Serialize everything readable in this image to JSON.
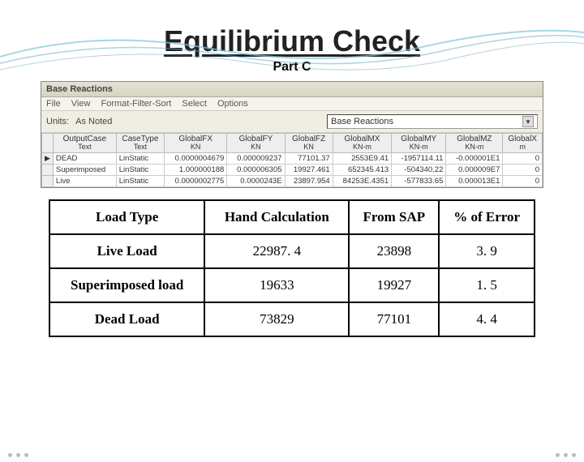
{
  "title": "Equilibrium Check",
  "subtitle": "Part C",
  "sap": {
    "window_title": "Base Reactions",
    "menus": [
      "File",
      "View",
      "Format-Filter-Sort",
      "Select",
      "Options"
    ],
    "units_label": "Units:",
    "units_value": "As Noted",
    "dropdown_value": "Base Reactions",
    "columns": [
      {
        "h1": "OutputCase",
        "h2": "Text"
      },
      {
        "h1": "CaseType",
        "h2": "Text"
      },
      {
        "h1": "GlobalFX",
        "h2": "KN"
      },
      {
        "h1": "GlobalFY",
        "h2": "KN"
      },
      {
        "h1": "GlobalFZ",
        "h2": "KN"
      },
      {
        "h1": "GlobalMX",
        "h2": "KN-m"
      },
      {
        "h1": "GlobalMY",
        "h2": "KN-m"
      },
      {
        "h1": "GlobalMZ",
        "h2": "KN-m"
      },
      {
        "h1": "GlobalX",
        "h2": "m"
      }
    ],
    "rows": [
      {
        "marker": "▶",
        "cells": [
          "DEAD",
          "LinStatic",
          "0.0000004679",
          "0.000009237",
          "77101.37",
          "2553E9.41",
          "-1957114.11",
          "-0.000001E1",
          "0"
        ]
      },
      {
        "marker": "",
        "cells": [
          "Superimposed",
          "LinStatic",
          "1.000000188",
          "0.000006305",
          "19927.461",
          "652345.413",
          "-504340.22",
          "0.000009E7",
          "0"
        ]
      },
      {
        "marker": "",
        "cells": [
          "Live",
          "LinStatic",
          "0.0000002775",
          "0.0000243E",
          "23897.954",
          "84253E.4351",
          "-577833.65",
          "0.000013E1",
          "0"
        ]
      }
    ]
  },
  "comparison": {
    "headers": [
      "Load Type",
      "Hand Calculation",
      "From SAP",
      "% of Error"
    ],
    "rows": [
      [
        "Live Load",
        "22987. 4",
        "23898",
        "3. 9"
      ],
      [
        "Superimposed load",
        "19633",
        "19927",
        "1. 5"
      ],
      [
        "Dead Load",
        "73829",
        "77101",
        "4. 4"
      ]
    ]
  }
}
